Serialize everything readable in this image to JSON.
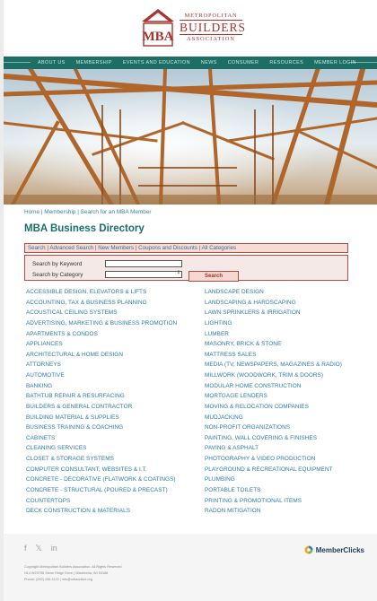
{
  "logo": {
    "line1": "METROPOLITAN",
    "line2": "BUILDERS",
    "line3": "ASSOCIATION",
    "monogram": "MBA"
  },
  "nav": {
    "items": [
      "ABOUT US",
      "MEMBERSHIP",
      "EVENTS AND EDUCATION",
      "NEWS",
      "CONSUMER",
      "RESOURCES",
      "MEMBER LOGIN"
    ]
  },
  "breadcrumb": {
    "home": "Home",
    "sep": " | ",
    "membership": "Membership",
    "current": "Search for an MBA Member"
  },
  "page_title": "MBA Business Directory",
  "linkbar": {
    "items": [
      "Search",
      "Advanced Search",
      "New Members",
      "Coupons and Discounts",
      "All Categories"
    ]
  },
  "search": {
    "keyword_label": "Search by Keyword",
    "keyword_value": "",
    "category_label": "Search by Category",
    "category_value": "",
    "button_label": "Search"
  },
  "categories": {
    "left": [
      "ACCESSIBLE DESIGN, ELEVATORS & LIFTS",
      "ACCOUNTING, TAX & BUSINESS PLANNING",
      "ACOUSTICAL CEILING SYSTEMS",
      "ADVERTISING, MARKETING & BUSINESS PROMOTION",
      "APARTMENTS & CONDOS",
      "APPLIANCES",
      "ARCHITECTURAL & HOME DESIGN",
      "ATTORNEYS",
      "AUTOMOTIVE",
      "BANKING",
      "BATHTUB REPAIR & RESURFACING",
      "BUILDERS & GENERAL CONTRACTOR",
      "BUILDING MATERIAL & SUPPLIES",
      "BUSINESS TRAINING & COACHING",
      "CABINETS",
      "CLEANING SERVICES",
      "CLOSET & STORAGE SYSTEMS",
      "COMPUTER CONSULTANT, WEBSITES & I.T.",
      "CONCRETE - DECORATIVE (FLATWORK & COATINGS)",
      "CONCRETE - STRUCTURAL (POURED & PRECAST)",
      "COUNTERTOPS",
      "DECK CONSTRUCTION & MATERIALS"
    ],
    "right": [
      "LANDSCAPE DESIGN",
      "LANDSCAPING & HARDSCAPING",
      "LAWN SPRINKLERS & IRRIGATION",
      "LIGHTING",
      "LUMBER",
      "MASONRY, BRICK & STONE",
      "MATTRESS SALES",
      "MEDIA (TV, NEWSPAPERS, MAGAZINES & RADIO)",
      "MILLWORK (WOODWORK, TRIM & DOORS)",
      "MODULAR HOME CONSTRUCTION",
      "MORTGAGE LENDERS",
      "MOVING & RELOCATION COMPANIES",
      "MUDJACKING",
      "NON-PROFIT ORGANIZATIONS",
      "PAINTING, WALL COVERING & FINISHES",
      "PAVING & ASPHALT",
      "PHOTOGRAPHY & VIDEO PRODUCTION",
      "PLAYGROUND & RECREATIONAL EQUIPMENT",
      "PLUMBING",
      "PORTABLE TOILETS",
      "PRINTING & PROMOTIONAL ITEMS",
      "RADON MITIGATION"
    ]
  },
  "footer": {
    "social": [
      "facebook-icon",
      "twitter-icon",
      "linkedin-icon"
    ],
    "social_glyphs": [
      "f",
      "𝕏",
      "in"
    ],
    "memberclicks": "MemberClicks",
    "copyright": "Copyright Metropolitan Builders Association. All Rights Reserved.",
    "address": "N14 W23755 Stone Ridge Drive  |  Waukesha, WI 53188",
    "contact": "Phone: (262) 436-1122  |  info@mbaonline.org"
  },
  "colors": {
    "brand_red": "#a8322d",
    "nav_teal": "#1d6f66",
    "link_blue": "#2d7aa8"
  }
}
